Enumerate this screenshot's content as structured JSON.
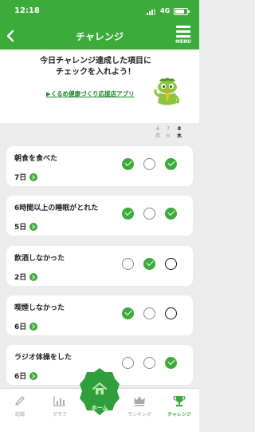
{
  "status": {
    "time": "12:18",
    "network": "4G"
  },
  "nav": {
    "title": "チャレンジ",
    "menu_label": "MENU"
  },
  "intro": {
    "message_line1": "今日チャレンジ達成した項目に",
    "message_line2": "チェックを入れよう！",
    "app_link": "▶くるめ健康づくり応援店アプリ"
  },
  "days": [
    {
      "number": "6",
      "weekday": "月",
      "today": false
    },
    {
      "number": "7",
      "weekday": "火",
      "today": false
    },
    {
      "number": "8",
      "weekday": "水",
      "today": true
    }
  ],
  "challenges": [
    {
      "title": "朝食を食べた",
      "streak": "7日",
      "marks": [
        true,
        false,
        true
      ]
    },
    {
      "title": "6時間以上の睡眠がとれた",
      "streak": "5日",
      "marks": [
        true,
        false,
        true
      ]
    },
    {
      "title": "飲酒しなかった",
      "streak": "2日",
      "marks": [
        false,
        true,
        false
      ]
    },
    {
      "title": "喫煙しなかった",
      "streak": "6日",
      "marks": [
        true,
        false,
        false
      ]
    },
    {
      "title": "ラジオ体操をした",
      "streak": "6日",
      "marks": [
        false,
        false,
        true
      ]
    }
  ],
  "tabs": [
    {
      "label": "記録",
      "icon": "pencil-icon"
    },
    {
      "label": "グラフ",
      "icon": "bar-chart-icon"
    },
    {
      "label": "ホーム",
      "icon": "home-icon"
    },
    {
      "label": "ランキング",
      "icon": "crown-icon"
    },
    {
      "label": "チャレンジ",
      "icon": "trophy-icon"
    }
  ],
  "colors": {
    "primary": "#3cab3a",
    "link": "#1f8a2b",
    "background": "#ececec",
    "mascot": "#8cc63f",
    "mascot_tie": "#f7c41a"
  }
}
